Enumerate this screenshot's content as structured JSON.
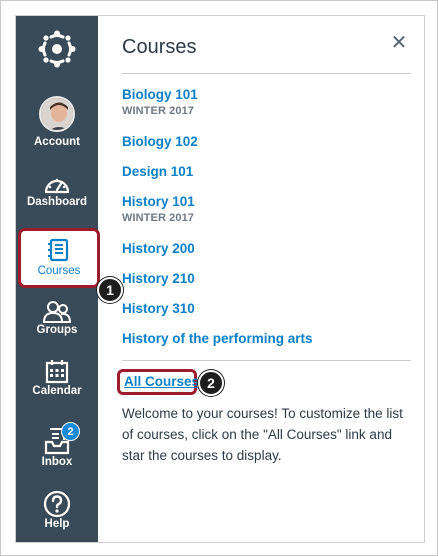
{
  "nav": {
    "account": "Account",
    "dashboard": "Dashboard",
    "courses": "Courses",
    "groups": "Groups",
    "calendar": "Calendar",
    "inbox": "Inbox",
    "inbox_badge": "2",
    "help": "Help"
  },
  "tray": {
    "title": "Courses",
    "close": "✕",
    "courses": [
      {
        "name": "Biology 101",
        "term": "WINTER 2017"
      },
      {
        "name": "Biology 102"
      },
      {
        "name": "Design 101"
      },
      {
        "name": "History 101",
        "term": "WINTER 2017"
      },
      {
        "name": "History 200"
      },
      {
        "name": "History 210"
      },
      {
        "name": "History 310"
      },
      {
        "name": "History of the performing arts"
      }
    ],
    "all_courses": "All Courses",
    "welcome": "Welcome to your courses! To customize the list of courses, click on the \"All Courses\" link and star the courses to display."
  },
  "callouts": [
    "1",
    "2"
  ],
  "colors": {
    "nav_bg": "#394b58",
    "link": "#0a80c8",
    "highlight": "#9d1b2c"
  }
}
